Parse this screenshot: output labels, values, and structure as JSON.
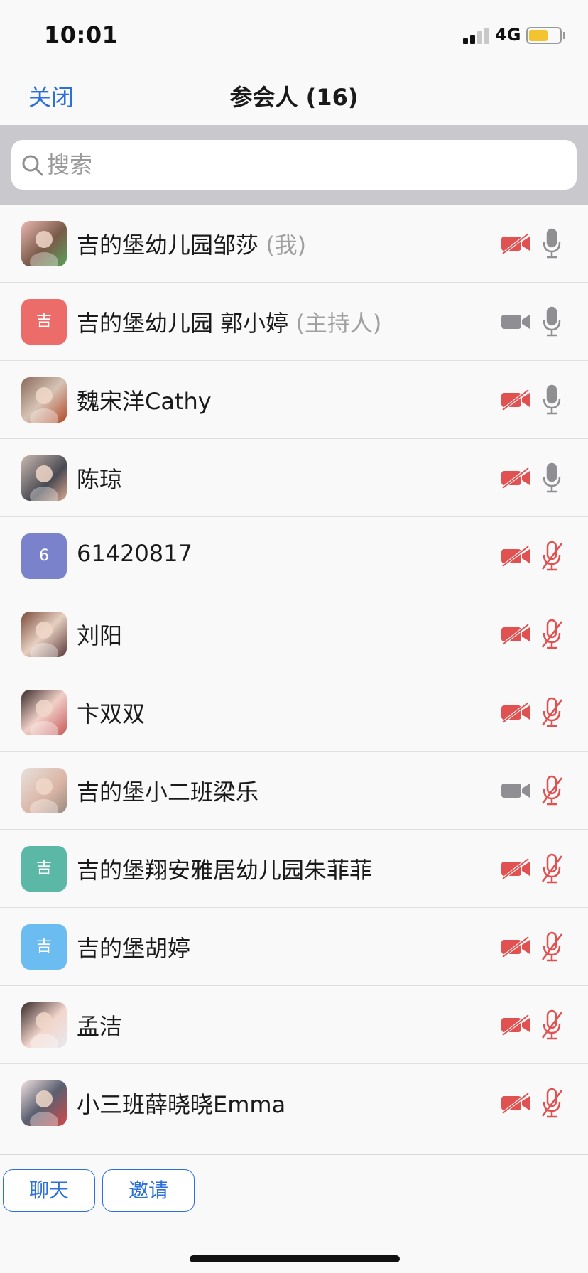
{
  "status_bar": {
    "time": "10:01",
    "network": "4G"
  },
  "nav": {
    "close_label": "关闭",
    "title": "参会人 (16)"
  },
  "search": {
    "placeholder": "搜索",
    "value": ""
  },
  "colors": {
    "accent": "#2d6fdb",
    "muted_red": "#e05252",
    "icon_gray": "#8e8e93"
  },
  "participants": [
    {
      "name": "吉的堡幼儿园邹莎",
      "tag": "(我)",
      "avatar": "photo",
      "video": "off",
      "mic": "on"
    },
    {
      "name": "吉的堡幼儿园 郭小婷",
      "tag": "(主持人)",
      "avatar": "letter",
      "avatar_letter": "吉",
      "avatar_color": "#ec6c6a",
      "video": "on",
      "mic": "on"
    },
    {
      "name": "魏宋洋Cathy",
      "tag": "",
      "avatar": "photo",
      "video": "off",
      "mic": "on"
    },
    {
      "name": "陈琼",
      "tag": "",
      "avatar": "photo",
      "video": "off",
      "mic": "on"
    },
    {
      "name": "61420817",
      "tag": "",
      "avatar": "letter",
      "avatar_letter": "6",
      "avatar_color": "#7b82cc",
      "video": "off",
      "mic": "off"
    },
    {
      "name": "刘阳",
      "tag": "",
      "avatar": "photo",
      "video": "off",
      "mic": "off"
    },
    {
      "name": "卞双双",
      "tag": "",
      "avatar": "photo",
      "video": "off",
      "mic": "off"
    },
    {
      "name": "吉的堡小二班梁乐",
      "tag": "",
      "avatar": "photo",
      "video": "on",
      "mic": "off"
    },
    {
      "name": "吉的堡翔安雅居幼儿园朱菲菲",
      "tag": "",
      "avatar": "letter",
      "avatar_letter": "吉",
      "avatar_color": "#5cb8a6",
      "video": "off",
      "mic": "off"
    },
    {
      "name": "吉的堡胡婷",
      "tag": "",
      "avatar": "letter",
      "avatar_letter": "吉",
      "avatar_color": "#6bbcf0",
      "video": "off",
      "mic": "off"
    },
    {
      "name": "孟洁",
      "tag": "",
      "avatar": "photo",
      "video": "off",
      "mic": "off"
    },
    {
      "name": "小三班薛晓晓Emma",
      "tag": "",
      "avatar": "photo",
      "video": "off",
      "mic": "off"
    }
  ],
  "bottom": {
    "chat_label": "聊天",
    "invite_label": "邀请"
  }
}
